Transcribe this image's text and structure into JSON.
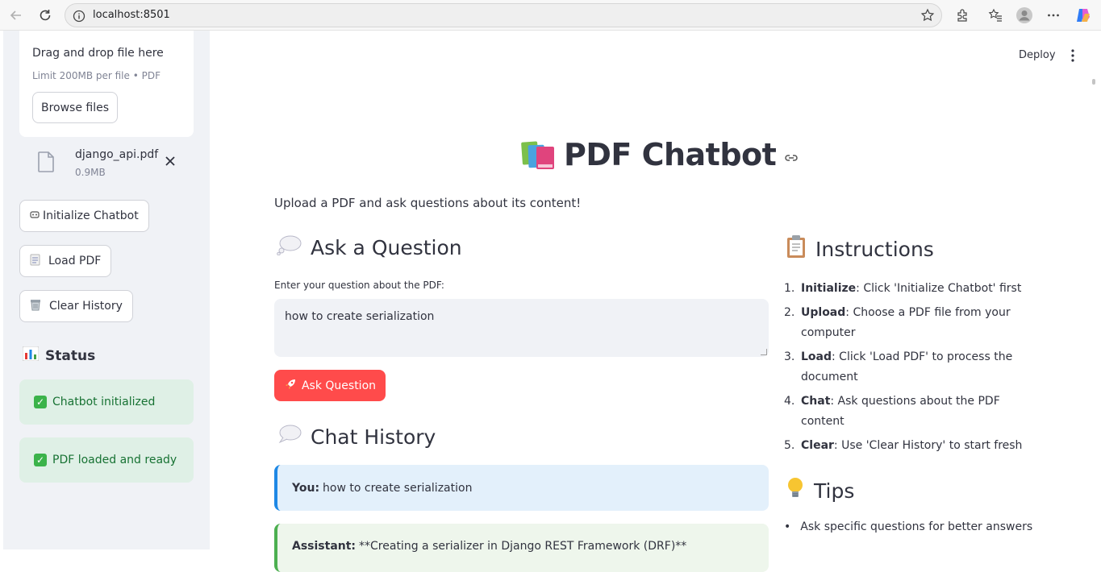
{
  "browser": {
    "url": "localhost:8501",
    "back_icon": "back-arrow-icon",
    "reload_icon": "reload-icon"
  },
  "sidebar": {
    "uploader": {
      "drop_title": "Drag and drop file here",
      "limit_text": "Limit 200MB per file • PDF",
      "browse_label": "Browse files"
    },
    "file": {
      "name": "django_api.pdf",
      "size": "0.9MB"
    },
    "buttons": {
      "initialize": "Initialize Chatbot",
      "load_pdf": "Load PDF",
      "clear_history": "Clear History"
    },
    "status_title": "Status",
    "status_messages": [
      "Chatbot initialized",
      "PDF loaded and ready"
    ]
  },
  "header": {
    "deploy_label": "Deploy"
  },
  "main": {
    "title": "PDF Chatbot",
    "subtitle": "Upload a PDF and ask questions about its content!",
    "ask_section": {
      "heading": "Ask a Question",
      "input_label": "Enter your question about the PDF:",
      "input_value": "how to create serialization",
      "ask_button": "Ask Question"
    },
    "chat_history": {
      "heading": "Chat History",
      "messages": [
        {
          "role": "You:",
          "text": "how to create serialization"
        },
        {
          "role": "Assistant:",
          "text": "**Creating a serializer in Django REST Framework (DRF)**"
        }
      ]
    },
    "instructions": {
      "heading": "Instructions",
      "items": [
        {
          "num": "1.",
          "bold": "Initialize",
          "text": ": Click 'Initialize Chatbot' first"
        },
        {
          "num": "2.",
          "bold": "Upload",
          "text": ": Choose a PDF file from your computer"
        },
        {
          "num": "3.",
          "bold": "Load",
          "text": ": Click 'Load PDF' to process the document"
        },
        {
          "num": "4.",
          "bold": "Chat",
          "text": ": Ask questions about the PDF content"
        },
        {
          "num": "5.",
          "bold": "Clear",
          "text": ": Use 'Clear History' to start fresh"
        }
      ]
    },
    "tips": {
      "heading": "Tips",
      "items": [
        "Ask specific questions for better answers"
      ]
    }
  },
  "colors": {
    "primary": "#ff4b4b",
    "sidebar_bg": "#f0f2f6",
    "success_bg": "#dff0e6",
    "success_text": "#177233",
    "user_msg_bg": "#e3f0fb",
    "assistant_msg_bg": "#eef6ec"
  }
}
